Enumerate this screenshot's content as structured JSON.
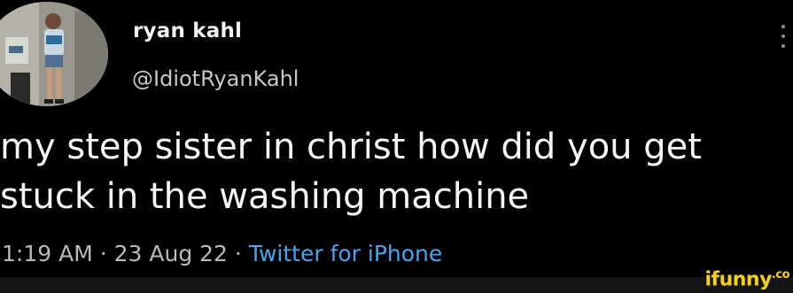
{
  "user": {
    "display_name": "ryan kahl",
    "handle": "@IdiotRyanKahl",
    "avatar_icon": "avatar-photo"
  },
  "tweet": {
    "lines": [
      "my step sister in christ how did you get",
      "stuck in the washing machine"
    ],
    "time": "1:19 AM",
    "date": "23 Aug 22",
    "source": "Twitter for iPhone",
    "separator": "·"
  },
  "menu": {
    "icon": "more-vertical-icon"
  },
  "watermark": {
    "text": "ifunny",
    "suffix": ".co",
    "color": "#f7d117"
  },
  "colors": {
    "background": "#000000",
    "text": "#f5f5f5",
    "secondary": "#b6b9bd",
    "link": "#4aa3f0"
  }
}
